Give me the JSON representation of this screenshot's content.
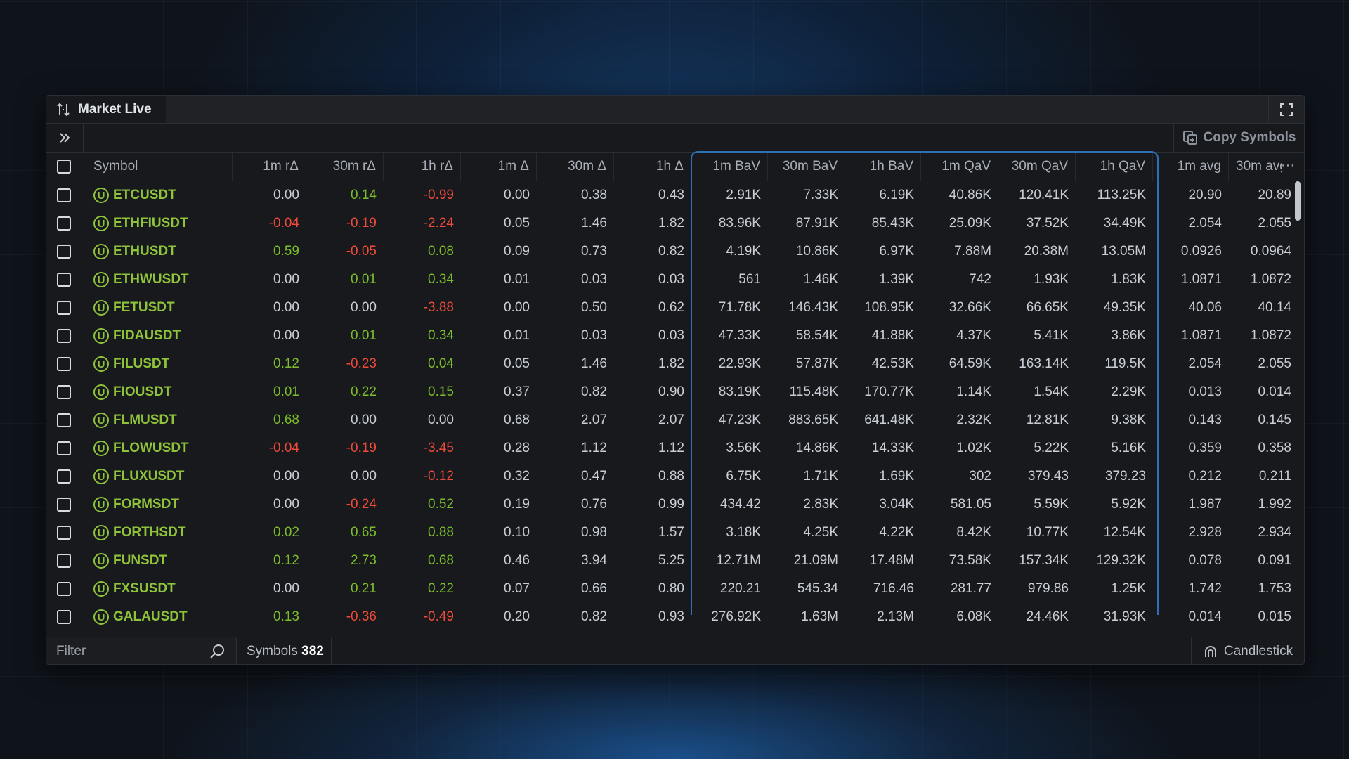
{
  "window": {
    "tab_title": "Market Live"
  },
  "toolbar": {
    "copy_label": "Copy Symbols"
  },
  "columns": [
    "Symbol",
    "1m rΔ",
    "30m rΔ",
    "1h rΔ",
    "1m Δ",
    "30m Δ",
    "1h Δ",
    "1m BaV",
    "30m BaV",
    "1h BaV",
    "1m QaV",
    "30m QaV",
    "1h QaV",
    "1m avg",
    "30m avg"
  ],
  "rows": [
    {
      "symbol": "ETCUSDT",
      "v": [
        "0.00",
        "0.14",
        "-0.99",
        "0.00",
        "0.38",
        "0.43",
        "2.91K",
        "7.33K",
        "6.19K",
        "40.86K",
        "120.41K",
        "113.25K",
        "20.90",
        "20.89"
      ],
      "c": [
        "neu",
        "pos",
        "neg"
      ]
    },
    {
      "symbol": "ETHFIUSDT",
      "v": [
        "-0.04",
        "-0.19",
        "-2.24",
        "0.05",
        "1.46",
        "1.82",
        "83.96K",
        "87.91K",
        "85.43K",
        "25.09K",
        "37.52K",
        "34.49K",
        "2.054",
        "2.055"
      ],
      "c": [
        "neg",
        "neg",
        "neg"
      ]
    },
    {
      "symbol": "ETHUSDT",
      "v": [
        "0.59",
        "-0.05",
        "0.08",
        "0.09",
        "0.73",
        "0.82",
        "4.19K",
        "10.86K",
        "6.97K",
        "7.88M",
        "20.38M",
        "13.05M",
        "0.0926",
        "0.0964"
      ],
      "c": [
        "pos",
        "neg",
        "pos"
      ]
    },
    {
      "symbol": "ETHWUSDT",
      "v": [
        "0.00",
        "0.01",
        "0.34",
        "0.01",
        "0.03",
        "0.03",
        "561",
        "1.46K",
        "1.39K",
        "742",
        "1.93K",
        "1.83K",
        "1.0871",
        "1.0872"
      ],
      "c": [
        "neu",
        "pos",
        "pos"
      ]
    },
    {
      "symbol": "FETUSDT",
      "v": [
        "0.00",
        "0.00",
        "-3.88",
        "0.00",
        "0.50",
        "0.62",
        "71.78K",
        "146.43K",
        "108.95K",
        "32.66K",
        "66.65K",
        "49.35K",
        "40.06",
        "40.14"
      ],
      "c": [
        "neu",
        "neu",
        "neg"
      ]
    },
    {
      "symbol": "FIDAUSDT",
      "v": [
        "0.00",
        "0.01",
        "0.34",
        "0.01",
        "0.03",
        "0.03",
        "47.33K",
        "58.54K",
        "41.88K",
        "4.37K",
        "5.41K",
        "3.86K",
        "1.0871",
        "1.0872"
      ],
      "c": [
        "neu",
        "pos",
        "pos"
      ]
    },
    {
      "symbol": "FILUSDT",
      "v": [
        "0.12",
        "-0.23",
        "0.04",
        "0.05",
        "1.46",
        "1.82",
        "22.93K",
        "57.87K",
        "42.53K",
        "64.59K",
        "163.14K",
        "119.5K",
        "2.054",
        "2.055"
      ],
      "c": [
        "pos",
        "neg",
        "pos"
      ]
    },
    {
      "symbol": "FIOUSDT",
      "v": [
        "0.01",
        "0.22",
        "0.15",
        "0.37",
        "0.82",
        "0.90",
        "83.19K",
        "115.48K",
        "170.77K",
        "1.14K",
        "1.54K",
        "2.29K",
        "0.013",
        "0.014"
      ],
      "c": [
        "pos",
        "pos",
        "pos"
      ]
    },
    {
      "symbol": "FLMUSDT",
      "v": [
        "0.68",
        "0.00",
        "0.00",
        "0.68",
        "2.07",
        "2.07",
        "47.23K",
        "883.65K",
        "641.48K",
        "2.32K",
        "12.81K",
        "9.38K",
        "0.143",
        "0.145"
      ],
      "c": [
        "pos",
        "neu",
        "neu"
      ]
    },
    {
      "symbol": "FLOWUSDT",
      "v": [
        "-0.04",
        "-0.19",
        "-3.45",
        "0.28",
        "1.12",
        "1.12",
        "3.56K",
        "14.86K",
        "14.33K",
        "1.02K",
        "5.22K",
        "5.16K",
        "0.359",
        "0.358"
      ],
      "c": [
        "neg",
        "neg",
        "neg"
      ]
    },
    {
      "symbol": "FLUXUSDT",
      "v": [
        "0.00",
        "0.00",
        "-0.12",
        "0.32",
        "0.47",
        "0.88",
        "6.75K",
        "1.71K",
        "1.69K",
        "302",
        "379.43",
        "379.23",
        "0.212",
        "0.211"
      ],
      "c": [
        "neu",
        "neu",
        "neg"
      ]
    },
    {
      "symbol": "FORMSDT",
      "v": [
        "0.00",
        "-0.24",
        "0.52",
        "0.19",
        "0.76",
        "0.99",
        "434.42",
        "2.83K",
        "3.04K",
        "581.05",
        "5.59K",
        "5.92K",
        "1.987",
        "1.992"
      ],
      "c": [
        "neu",
        "neg",
        "pos"
      ]
    },
    {
      "symbol": "FORTHSDT",
      "v": [
        "0.02",
        "0.65",
        "0.88",
        "0.10",
        "0.98",
        "1.57",
        "3.18K",
        "4.25K",
        "4.22K",
        "8.42K",
        "10.77K",
        "12.54K",
        "2.928",
        "2.934"
      ],
      "c": [
        "pos",
        "pos",
        "pos"
      ]
    },
    {
      "symbol": "FUNSDT",
      "v": [
        "0.12",
        "2.73",
        "0.68",
        "0.46",
        "3.94",
        "5.25",
        "12.71M",
        "21.09M",
        "17.48M",
        "73.58K",
        "157.34K",
        "129.32K",
        "0.078",
        "0.091"
      ],
      "c": [
        "pos",
        "pos",
        "pos"
      ]
    },
    {
      "symbol": "FXSUSDT",
      "v": [
        "0.00",
        "0.21",
        "0.22",
        "0.07",
        "0.66",
        "0.80",
        "220.21",
        "545.34",
        "716.46",
        "281.77",
        "979.86",
        "1.25K",
        "1.742",
        "1.753"
      ],
      "c": [
        "neu",
        "pos",
        "pos"
      ]
    },
    {
      "symbol": "GALAUSDT",
      "v": [
        "0.13",
        "-0.36",
        "-0.49",
        "0.20",
        "0.82",
        "0.93",
        "276.92K",
        "1.63M",
        "2.13M",
        "6.08K",
        "24.46K",
        "31.93K",
        "0.014",
        "0.015"
      ],
      "c": [
        "pos",
        "neg",
        "neg"
      ]
    }
  ],
  "footer": {
    "filter_placeholder": "Filter",
    "symbols_label": "Symbols",
    "symbols_count": "382",
    "candle_label": "Candlestick"
  },
  "badge_letter": "U",
  "icons": [
    "sort-icon",
    "fullscreen-icon",
    "double-chevron-right-icon",
    "copy-icon",
    "more-icon",
    "search-icon",
    "candlestick-icon"
  ],
  "colors": {
    "positive": "#7cbd2a",
    "negative": "#ef4a3a",
    "symbol": "#8fc33a",
    "group_highlight": "#2f6fb5"
  }
}
